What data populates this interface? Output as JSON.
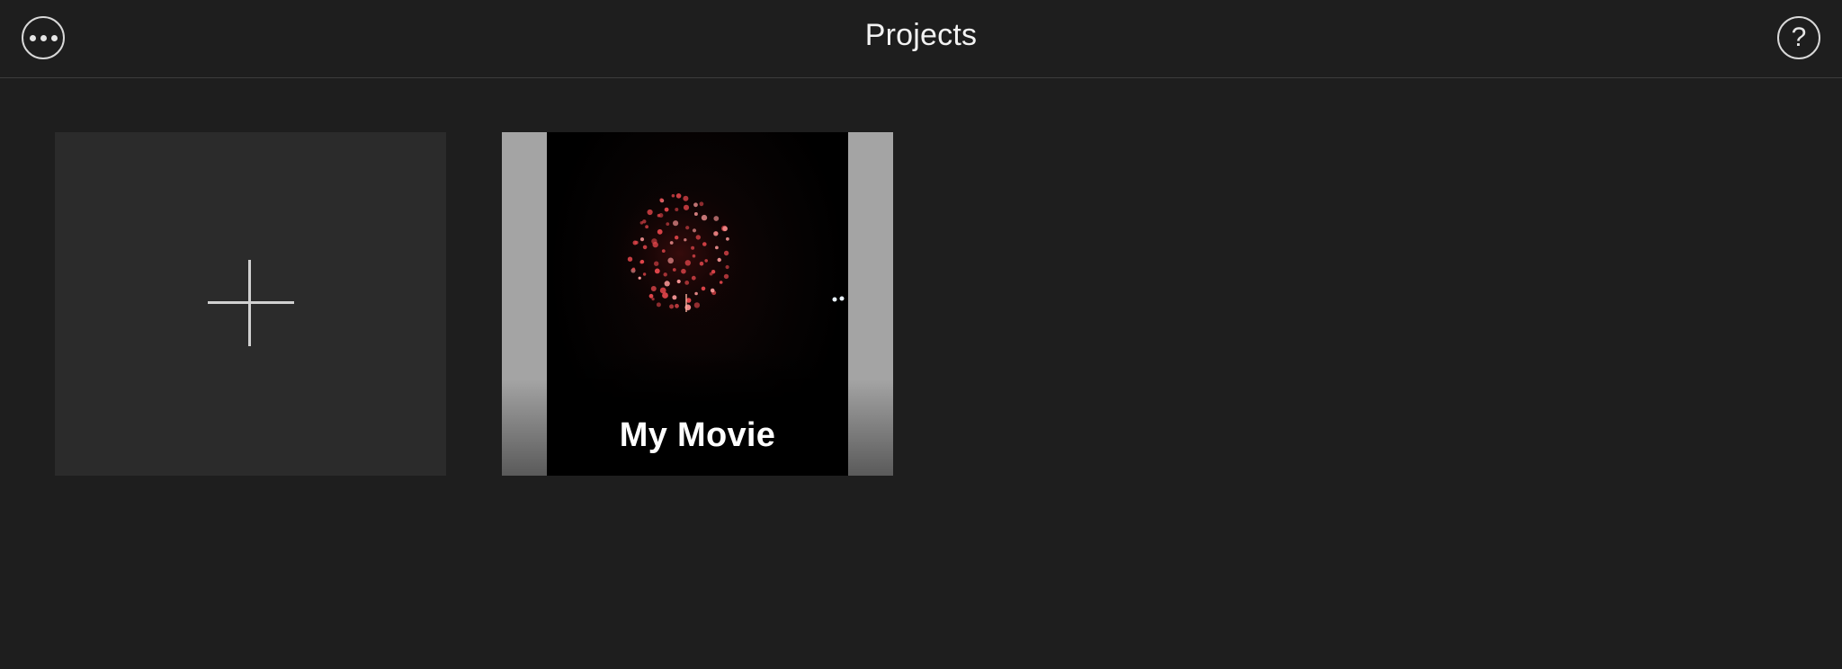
{
  "navbar": {
    "title": "Projects",
    "more_icon": "ellipsis-icon",
    "help_label": "?",
    "help_icon": "question-mark-icon"
  },
  "projects": {
    "new_project_icon": "plus-icon",
    "items": [
      {
        "title": "My Movie",
        "thumbnail": "fireworks-night-scene"
      }
    ]
  },
  "colors": {
    "background": "#1e1e1e",
    "tile": "#2b2b2b",
    "accent_text": "#ffffff",
    "firework": "#e0454a"
  }
}
